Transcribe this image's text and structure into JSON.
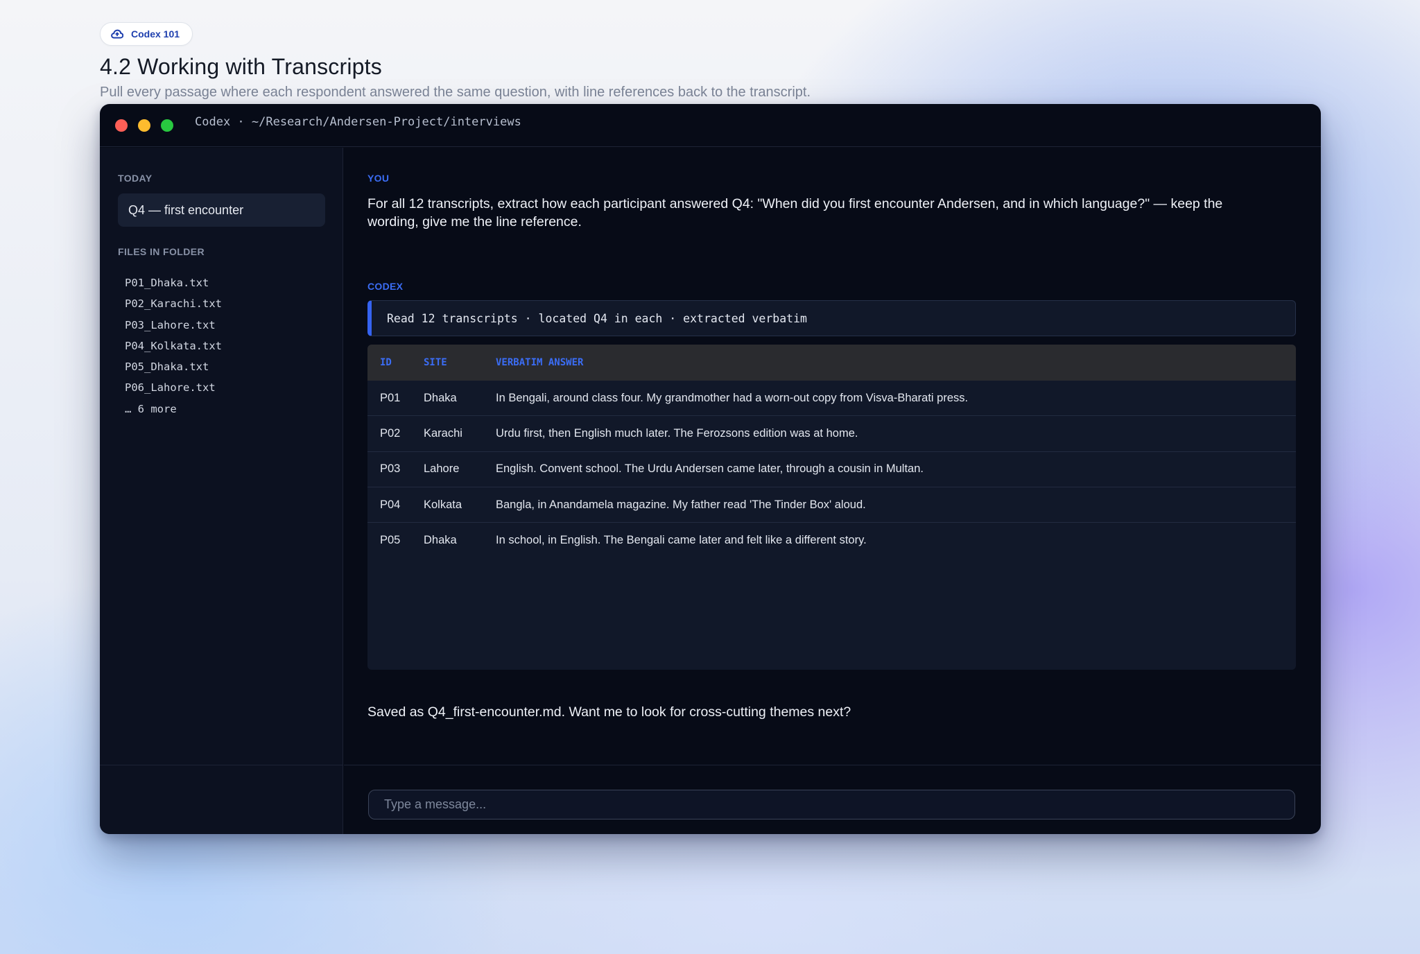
{
  "header": {
    "badge_label": "Codex 101",
    "title": "4.2 Working with Transcripts",
    "subtitle": "Pull every passage where each respondent answered the same question, with line references back to the transcript."
  },
  "window": {
    "title": "Codex · ~/Research/Andersen-Project/interviews"
  },
  "sidebar": {
    "today_heading": "TODAY",
    "chat_item": "Q4 — first encounter",
    "files_heading": "FILES IN FOLDER",
    "files": [
      "P01_Dhaka.txt",
      "P02_Karachi.txt",
      "P03_Lahore.txt",
      "P04_Kolkata.txt",
      "P05_Dhaka.txt",
      "P06_Lahore.txt",
      "… 6 more"
    ]
  },
  "conversation": {
    "you_label": "YOU",
    "user_message": "For all 12 transcripts, extract how each participant answered Q4: \"When did you first encounter Andersen, and in which language?\" — keep the wording, give me the line reference.",
    "codex_label": "CODEX",
    "status": "Read 12 transcripts · located Q4 in each · extracted verbatim",
    "table": {
      "headers": [
        "ID",
        "SITE",
        "VERBATIM ANSWER"
      ],
      "rows": [
        [
          "P01",
          "Dhaka",
          "In Bengali, around class four. My grandmother had a worn-out copy from Visva-Bharati press."
        ],
        [
          "P02",
          "Karachi",
          "Urdu first, then English much later. The Ferozsons edition was at home."
        ],
        [
          "P03",
          "Lahore",
          "English. Convent school. The Urdu Andersen came later, through a cousin in Multan."
        ],
        [
          "P04",
          "Kolkata",
          "Bangla, in Anandamela magazine. My father read 'The Tinder Box' aloud."
        ],
        [
          "P05",
          "Dhaka",
          "In school, in English. The Bengali came later and felt like a different story."
        ]
      ]
    },
    "assistant_message": "Saved as Q4_first-encounter.md. Want me to look for cross-cutting themes next?"
  },
  "composer": {
    "placeholder": "Type a message..."
  },
  "colors": {
    "accent": "#3b6df5",
    "window_bg": "#070b17",
    "sidebar_bg": "#0c1120",
    "close": "#fe5f57",
    "minimize": "#febc2e",
    "maximize": "#28c840"
  }
}
